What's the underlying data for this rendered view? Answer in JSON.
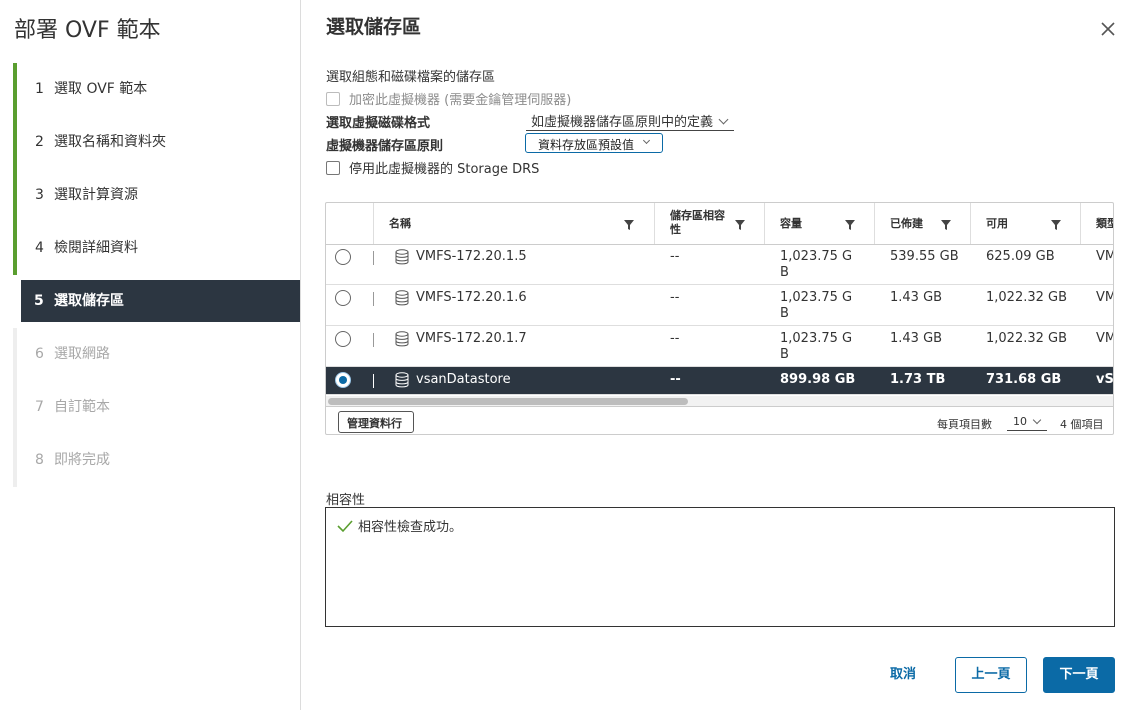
{
  "wizard": {
    "title": "部署 OVF 範本",
    "steps": [
      {
        "num": "1",
        "label": "選取 OVF 範本"
      },
      {
        "num": "2",
        "label": "選取名稱和資料夾"
      },
      {
        "num": "3",
        "label": "選取計算資源"
      },
      {
        "num": "4",
        "label": "檢閱詳細資料"
      },
      {
        "num": "5",
        "label": "選取儲存區"
      },
      {
        "num": "6",
        "label": "選取網路"
      },
      {
        "num": "7",
        "label": "自訂範本"
      },
      {
        "num": "8",
        "label": "即將完成"
      }
    ]
  },
  "main": {
    "title": "選取儲存區",
    "section_label": "選取組態和磁碟檔案的儲存區",
    "encrypt_label": "加密此虛擬機器 (需要金鑰管理伺服器)",
    "disk_format_label": "選取虛擬磁碟格式",
    "disk_format_value": "如虛擬機器儲存區原則中的定義",
    "policy_label": "虛擬機器儲存區原則",
    "policy_value": "資料存放區預設值",
    "drs_label": "停用此虛擬機器的 Storage DRS"
  },
  "grid": {
    "columns": {
      "name": "名稱",
      "compat": "儲存區相容性",
      "capacity": "容量",
      "provisioned": "已佈建",
      "free": "可用",
      "type": "類型"
    },
    "rows": [
      {
        "name": "VMFS-172.20.1.5",
        "compat": "--",
        "capacity": "1,023.75 GB",
        "provisioned": "539.55 GB",
        "free": "625.09 GB",
        "type": "VM"
      },
      {
        "name": "VMFS-172.20.1.6",
        "compat": "--",
        "capacity": "1,023.75 GB",
        "provisioned": "1.43 GB",
        "free": "1,022.32 GB",
        "type": "VM"
      },
      {
        "name": "VMFS-172.20.1.7",
        "compat": "--",
        "capacity": "1,023.75 GB",
        "provisioned": "1.43 GB",
        "free": "1,022.32 GB",
        "type": "VM"
      },
      {
        "name": "vsanDatastore",
        "compat": "--",
        "capacity": "899.98 GB",
        "provisioned": "1.73 TB",
        "free": "731.68 GB",
        "type": "vS"
      }
    ],
    "manage_columns": "管理資料行",
    "per_page_label": "每頁項目數",
    "per_page_value": "10",
    "item_count": "4 個項目"
  },
  "compatibility": {
    "label": "相容性",
    "message": "相容性檢查成功。"
  },
  "buttons": {
    "cancel": "取消",
    "back": "上一頁",
    "next": "下一頁"
  },
  "colors": {
    "accent": "#0b6aa6",
    "done_step": "#5a9e2f",
    "selected_row": "#2c3641",
    "success": "#5a9e2f"
  }
}
